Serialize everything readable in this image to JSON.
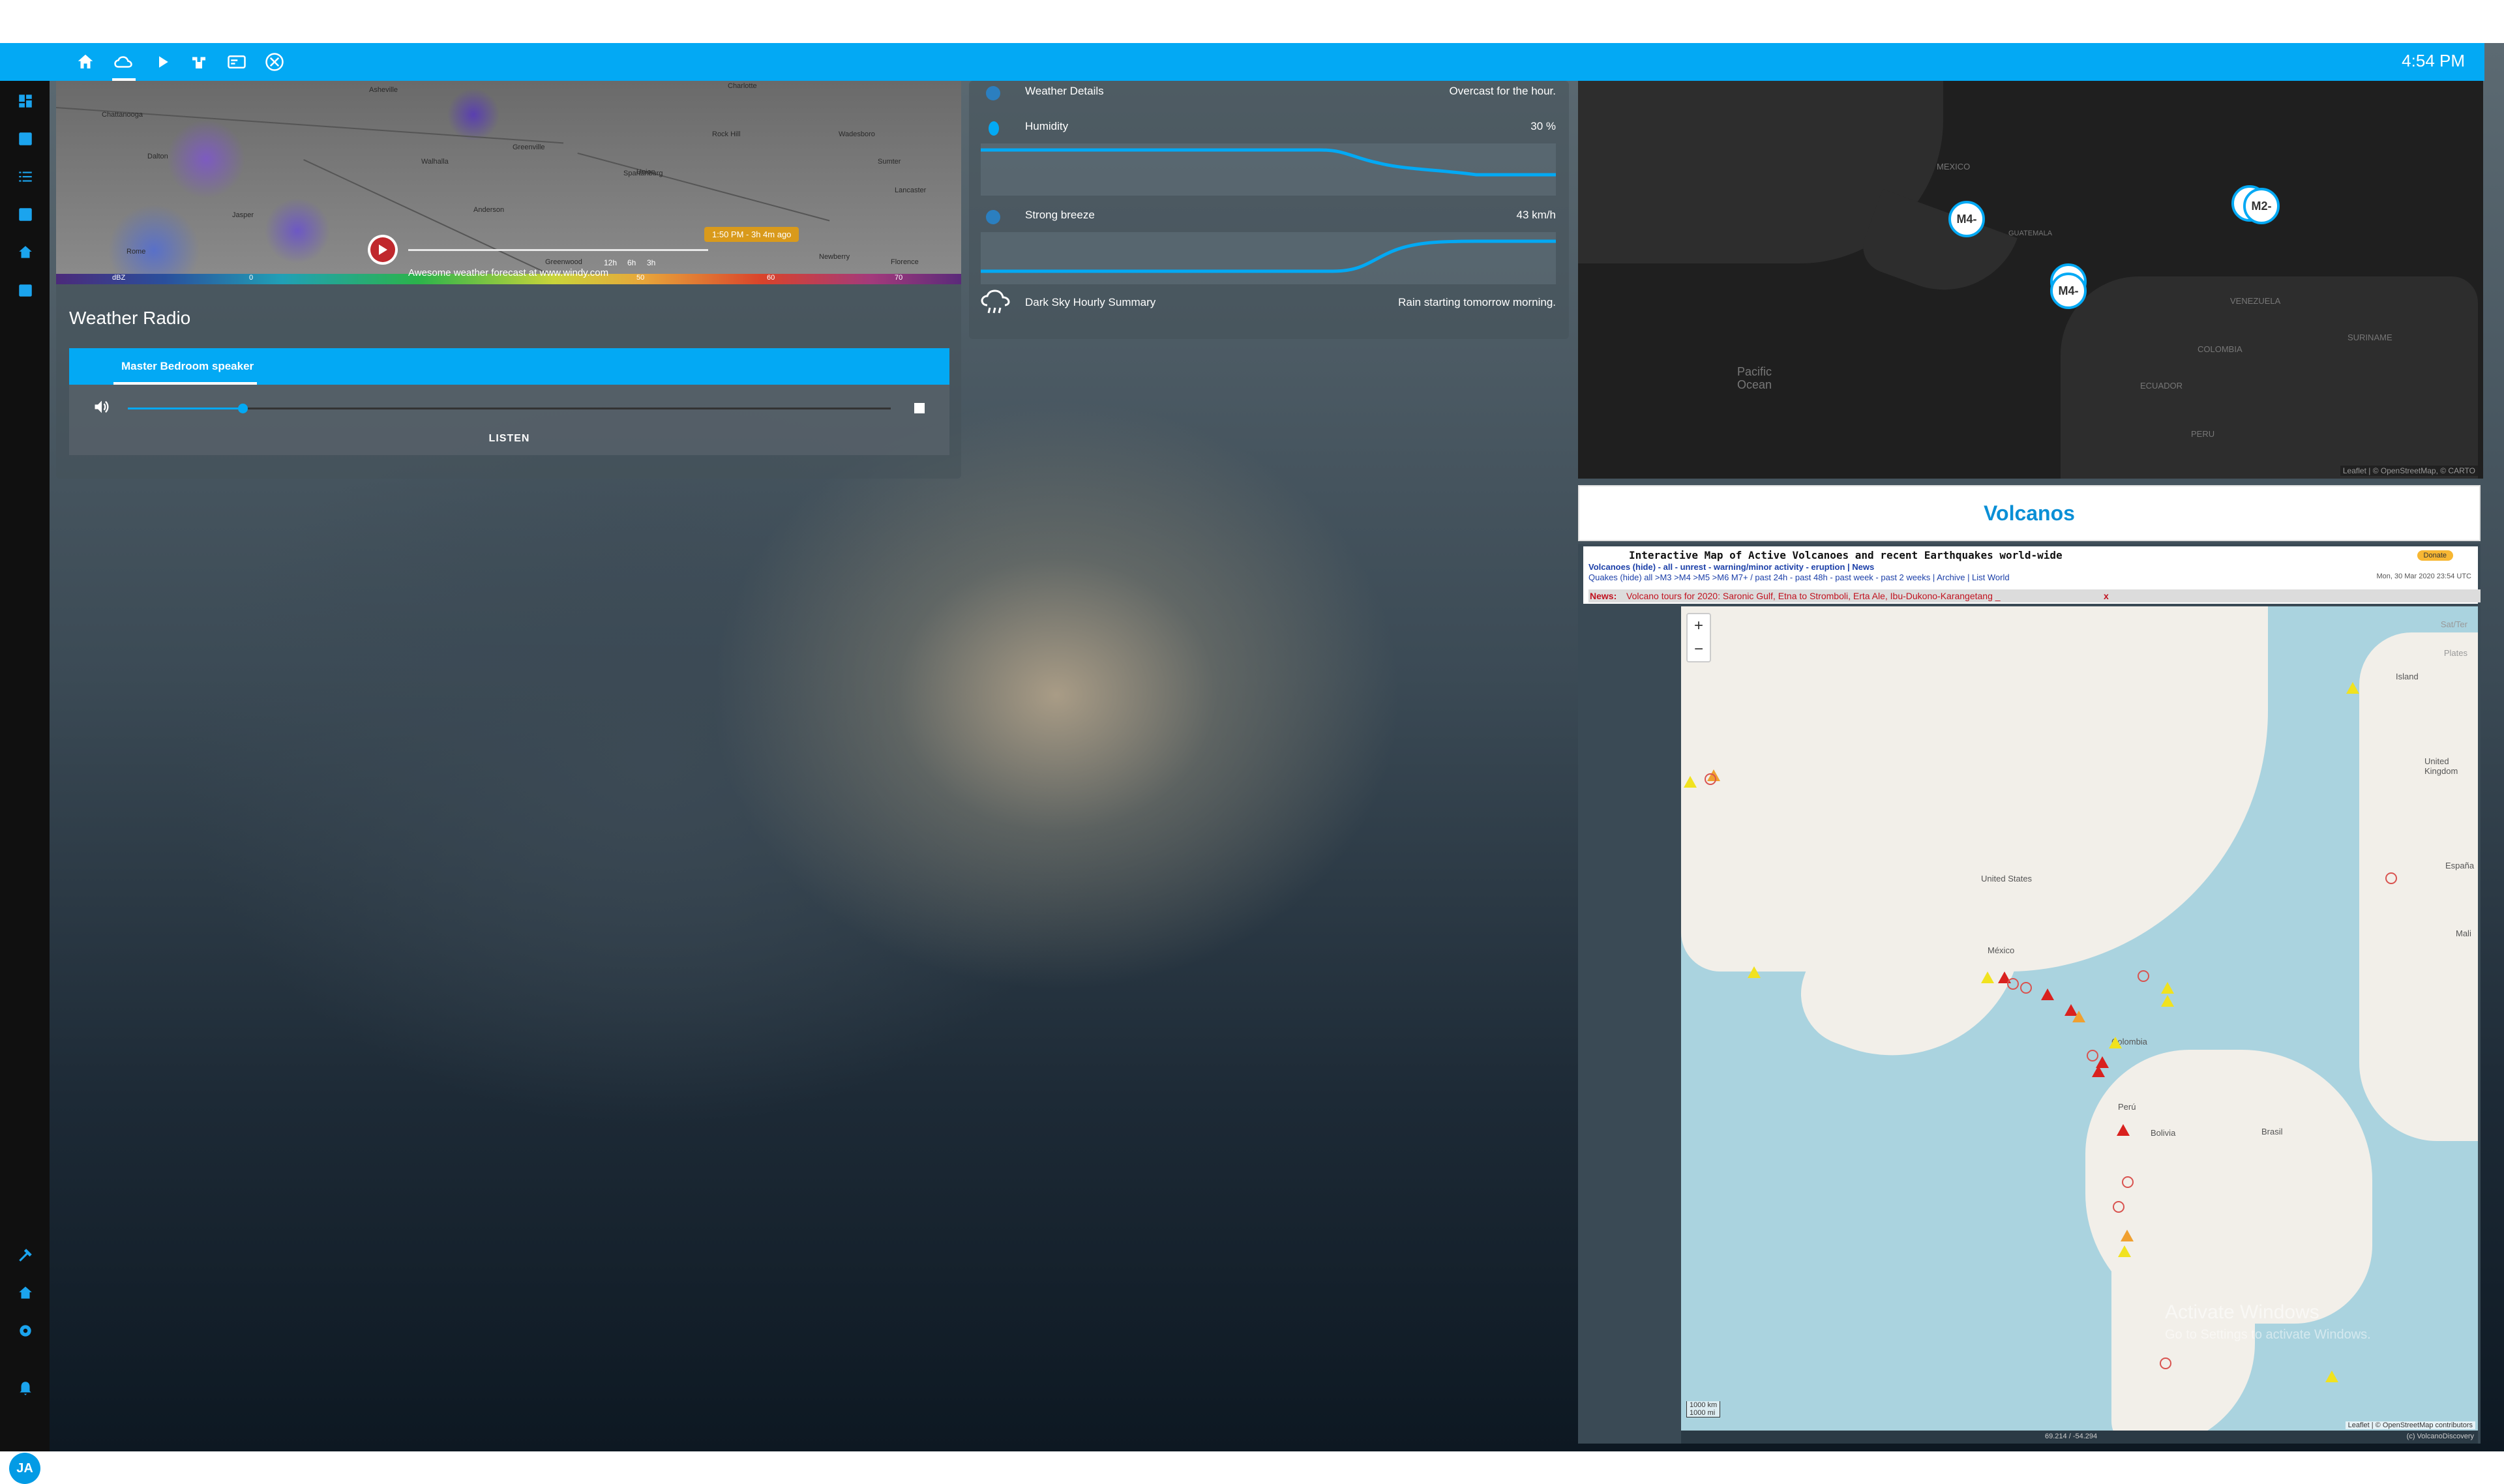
{
  "topbar": {
    "time": "4:54 PM",
    "icons": [
      "home-icon",
      "cloud-icon",
      "play-icon",
      "robot-icon",
      "card-icon",
      "xbox-icon"
    ]
  },
  "sidebar": {
    "avatar_initials": "JA",
    "icons": [
      "menu-icon",
      "dashboard-icon",
      "account-box-icon",
      "list-icon",
      "chart-icon",
      "home-icon",
      "calendar-icon",
      "hammer-icon",
      "settings-remote-icon",
      "gear-icon",
      "bell-icon"
    ]
  },
  "radar": {
    "badge": "1:50 PM - 3h 4m ago",
    "credit": "Awesome weather forecast at www.windy.com",
    "hours": [
      "12h",
      "6h",
      "3h"
    ],
    "scale": [
      "dBZ",
      "0",
      "50",
      "60",
      "70"
    ],
    "towns": [
      "Chattanooga",
      "Asheville",
      "Charlotte",
      "Greenville",
      "Anderson",
      "Jasper",
      "Rome",
      "Rock Hill",
      "Lancaster",
      "Florence",
      "Greenwood",
      "Newberry",
      "Spartanburg",
      "Walhalla",
      "Dalton",
      "Union",
      "Sumter",
      "Wadesboro"
    ]
  },
  "radio": {
    "title": "Weather Radio",
    "tab": "Master Bedroom speaker",
    "volume": 0.15,
    "listen": "LISTEN"
  },
  "weather": {
    "details_label": "Weather Details",
    "details_value": "Overcast for the hour.",
    "humidity_label": "Humidity",
    "humidity_value": "30 %",
    "wind_label": "Strong breeze",
    "wind_value": "43 km/h",
    "summary_label": "Dark Sky Hourly Summary",
    "summary_value": "Rain starting tomorrow morning."
  },
  "quake_map": {
    "markers": [
      "M4-",
      "M4-",
      "M2-",
      "M"
    ],
    "labels": [
      "MEXICO",
      "GUATEMALA",
      "VENEZUELA",
      "COLOMBIA",
      "SURINAME",
      "Pacific Ocean",
      "PERU",
      "ECUADOR"
    ],
    "attribution": "Leaflet | © OpenStreetMap, © CARTO"
  },
  "volcanos": {
    "title": "Volcanos",
    "heading": "Interactive Map of Active Volcanoes and recent Earthquakes world-wide",
    "row1": "Volcanoes (hide) - all - unrest - warning/minor activity - eruption | News",
    "row2": "Quakes (hide) all >M3 >M4 >M5 >M6 M7+ / past 24h - past 48h - past week - past 2 weeks | Archive | List  World",
    "date": "Mon, 30 Mar 2020 23:54 UTC",
    "donate": "Donate",
    "news_label": "News:",
    "news_text": "Volcano tours for 2020: Saronic Gulf, Etna to Stromboli, Erta Ale, Ibu-Dukono-Karangetang _",
    "news_close": "x",
    "layers": [
      "Sat/Ter",
      "Plates"
    ],
    "map_labels": [
      "United States",
      "México",
      "Colombia",
      "Perú",
      "Bolivia",
      "Brasil",
      "Island",
      "United Kingdom",
      "España",
      "Mali"
    ],
    "scale": [
      "1000 km",
      "1000 mi"
    ],
    "attribution": "Leaflet | © OpenStreetMap contributors",
    "footer_coords": "69.214 / -54.294",
    "footer_credit": "(c) VolcanoDiscovery"
  },
  "watermark": {
    "line1": "Activate Windows",
    "line2": "Go to Settings to activate Windows."
  }
}
